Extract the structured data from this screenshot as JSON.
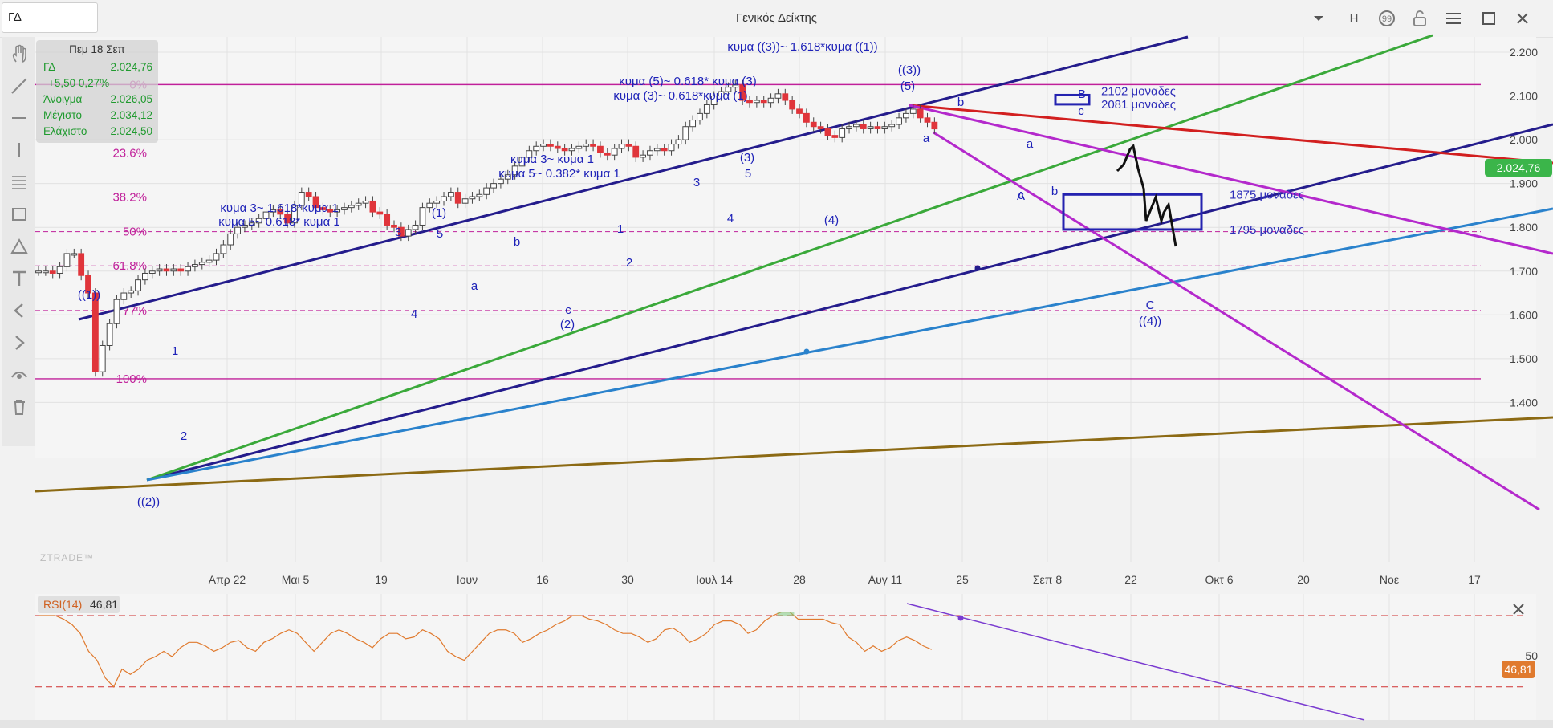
{
  "window": {
    "symbol": "ΓΔ",
    "title": "Γενικός Δείκτης",
    "mode_label": "H"
  },
  "infobox": {
    "date": "Πεμ 18 Σεπ",
    "rows": [
      {
        "label": "ΓΔ",
        "value": "2.024,76"
      },
      {
        "label": "+5,50 0,27%",
        "value": ""
      },
      {
        "label": "Άνοιγμα",
        "value": "2.026,05"
      },
      {
        "label": "Μέγιστο",
        "value": "2.034,12"
      },
      {
        "label": "Ελάχιστο",
        "value": "2.024,50"
      }
    ]
  },
  "watermark": "ZTRADE™",
  "colors": {
    "up_candle": "#ffffff",
    "down_candle": "#e0353b",
    "fib_line": "#c0209a",
    "wave_label": "#1e22b8",
    "channel_navy": "#241c8c",
    "channel_green": "#3aa93a",
    "channel_blue": "#2a82cc",
    "trend_red": "#d21f1f",
    "trend_purple": "#b429cc",
    "trend_olive": "#8c6a14",
    "rsi_line": "#e07a2e",
    "price_tag": "#3bb54a"
  },
  "chart_data": {
    "type": "candlestick",
    "ylim": [
      1350,
      2250
    ],
    "y_ticks": [
      "2.200",
      "2.100",
      "2.000",
      "1.900",
      "1.800",
      "1.700",
      "1.600",
      "1.500",
      "1.400"
    ],
    "x_ticks": [
      "Απρ 22",
      "Μαι 5",
      "19",
      "Ιουν",
      "16",
      "30",
      "Ιουλ 14",
      "28",
      "Αυγ 11",
      "25",
      "Σεπ 8",
      "22",
      "Οκτ 6",
      "20",
      "Νοε",
      "17"
    ],
    "last_price_label": "2.024,76",
    "closes": [
      1700,
      1700,
      1695,
      1710,
      1740,
      1740,
      1690,
      1650,
      1470,
      1530,
      1580,
      1635,
      1650,
      1655,
      1680,
      1695,
      1700,
      1705,
      1700,
      1705,
      1700,
      1710,
      1715,
      1720,
      1725,
      1740,
      1760,
      1785,
      1800,
      1805,
      1810,
      1820,
      1835,
      1840,
      1830,
      1810,
      1850,
      1880,
      1870,
      1845,
      1840,
      1835,
      1840,
      1845,
      1850,
      1855,
      1860,
      1835,
      1830,
      1805,
      1800,
      1780,
      1795,
      1805,
      1845,
      1855,
      1860,
      1870,
      1880,
      1855,
      1865,
      1870,
      1875,
      1890,
      1900,
      1910,
      1920,
      1940,
      1960,
      1975,
      1985,
      1990,
      1985,
      1980,
      1975,
      1980,
      1985,
      1990,
      1985,
      1970,
      1965,
      1980,
      1990,
      1985,
      1960,
      1965,
      1975,
      1980,
      1975,
      1990,
      2000,
      2030,
      2045,
      2060,
      2080,
      2100,
      2110,
      2120,
      2125,
      2090,
      2085,
      2090,
      2085,
      2095,
      2105,
      2090,
      2070,
      2060,
      2040,
      2030,
      2025,
      2010,
      2005,
      2025,
      2030,
      2035,
      2025,
      2030,
      2025,
      2030,
      2035,
      2050,
      2060,
      2070,
      2050,
      2040,
      2024.76
    ],
    "fib_levels": [
      {
        "label": "0%",
        "price": 2126
      },
      {
        "label": "23.6%",
        "price": 1970
      },
      {
        "label": "38.2%",
        "price": 1869
      },
      {
        "label": "50%",
        "price": 1790
      },
      {
        "label": "61.8%",
        "price": 1712
      },
      {
        "label": "77%",
        "price": 1610
      },
      {
        "label": "100%",
        "price": 1454
      }
    ],
    "projection_boxes": [
      {
        "label_top": "1875 μοναδες",
        "label_bottom": "1795  μοναδες",
        "top": 1875,
        "bottom": 1795
      },
      {
        "label_top": "2102 μοναδες",
        "label_bottom": "2081  μοναδες",
        "top": 2102,
        "bottom": 2081
      }
    ],
    "wave_labels": [
      "((1))",
      "((2))",
      "1",
      "2",
      "3",
      "4",
      "5",
      "(1)",
      "a",
      "b",
      "c",
      "(2)",
      "1",
      "2",
      "3",
      "4",
      "5",
      "(3)",
      "(4)",
      "((3))",
      "(5)",
      "b",
      "a",
      "a",
      "b",
      "c",
      "A",
      "B",
      "c",
      "C",
      "((4))"
    ],
    "annotations": [
      "κυμα ((3))~ 1.618*κυμα ((1))",
      "κυμα (5)~ 0.618* κυμα  (3)",
      "κυμα (3)~ 0.618*κυμα (1)",
      "κυμα 3~ κυμα 1",
      "κυμα 5~ 0.382* κυμα 1",
      "κυμα 3~ 1.618*κυμα 1",
      "κυμα 5~ 0.618* κυμα 1"
    ]
  },
  "rsi_panel": {
    "label": "RSI(14)",
    "value": "46,81",
    "tick_label": "50",
    "overbought": 70,
    "oversold": 30,
    "values": [
      70,
      70,
      70,
      68,
      65,
      60,
      50,
      45,
      35,
      30,
      40,
      37,
      40,
      45,
      47,
      50,
      47,
      52,
      55,
      55,
      53,
      50,
      52,
      55,
      56,
      52,
      50,
      55,
      57,
      60,
      62,
      60,
      55,
      50,
      55,
      60,
      62,
      60,
      57,
      55,
      52,
      57,
      60,
      60,
      57,
      58,
      62,
      60,
      57,
      50,
      47,
      45,
      50,
      55,
      60,
      62,
      62,
      60,
      55,
      57,
      60,
      62,
      65,
      67,
      70,
      70,
      68,
      67,
      65,
      62,
      60,
      60,
      58,
      55,
      57,
      62,
      63,
      60,
      55,
      57,
      60,
      65,
      67,
      67,
      65,
      60,
      62,
      67,
      70,
      72,
      72,
      68,
      68,
      68,
      68,
      66,
      65,
      58,
      55,
      50,
      53,
      50,
      52,
      56,
      58,
      56,
      53,
      51
    ]
  }
}
